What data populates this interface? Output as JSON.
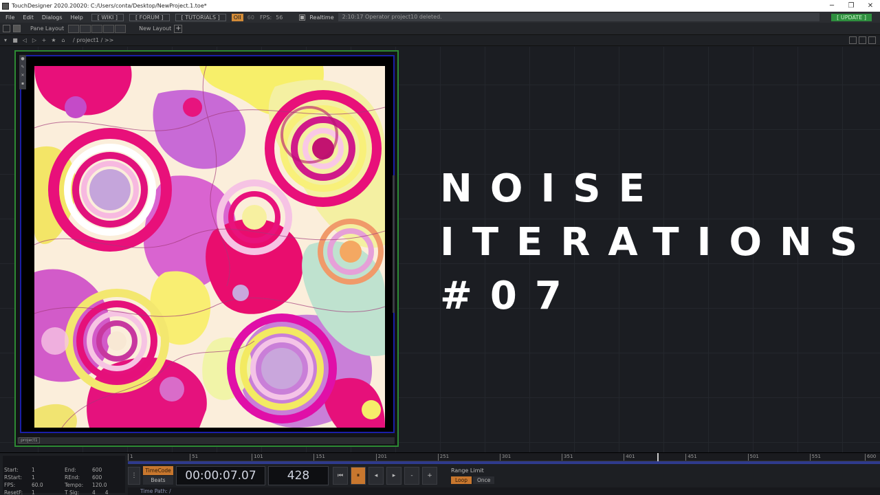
{
  "window": {
    "title": "TouchDesigner 2020.20020: C:/Users/conta/Desktop/NewProject.1.toe*",
    "controls": [
      "─",
      "❐",
      "✕"
    ]
  },
  "menubar": {
    "items": [
      "File",
      "Edit",
      "Dialogs",
      "Help"
    ],
    "buttons": [
      "[ WIKI ]",
      "[ FORUM ]",
      "[ TUTORIALS ]"
    ],
    "fps_badge": "OII",
    "fps_target": "60",
    "fps_label": "FPS:",
    "fps_value": "56",
    "realtime_label": "Realtime",
    "status_message": "2:10:17 Operator project10 deleted.",
    "update_label": "[ UPDATE ]"
  },
  "panebar": {
    "pane_layout_label": "Pane Layout",
    "new_layout_label": "New Layout",
    "add_label": "+"
  },
  "pathbar": {
    "path": "/ project1 / >>"
  },
  "operator": {
    "name": "project1"
  },
  "overlay": {
    "line1": "NOISE",
    "line2": "ITERATIONS",
    "line3": "#07"
  },
  "stats": {
    "start_label": "Start:",
    "start": "1",
    "end_label": "End:",
    "end": "600",
    "rstart_label": "RStart:",
    "rstart": "1",
    "rend_label": "REnd:",
    "rend": "600",
    "fps_label": "FPS:",
    "fps": "60.0",
    "tempo_label": "Tempo:",
    "tempo": "120.0",
    "resetf_label": "ResetF:",
    "resetf": "1",
    "tsig_label": "T Sig:",
    "tsig_a": "4",
    "tsig_b": "4"
  },
  "timeline": {
    "ticks": [
      "1",
      "51",
      "101",
      "151",
      "201",
      "251",
      "301",
      "351",
      "401",
      "451",
      "501",
      "551",
      "600"
    ],
    "playhead_frame": 428,
    "range": [
      1,
      600
    ]
  },
  "transport": {
    "timecode_label": "TimeCode",
    "beats_label": "Beats",
    "timecode": "00:00:07.07",
    "frame": "428",
    "minus": "-",
    "plus": "+",
    "range_limit_label": "Range Limit",
    "loop_label": "Loop",
    "once_label": "Once"
  },
  "timepath": {
    "label": "Time Path: /"
  },
  "colors": {
    "accent_orange": "#c8772e",
    "op_border_green": "#2d8a34",
    "op_inner_blue": "#1a1fa8",
    "update_green": "#2e8f3e"
  }
}
